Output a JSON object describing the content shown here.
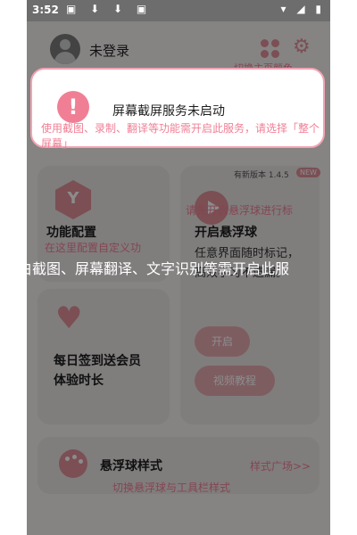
{
  "status_bar": {
    "time": "3:52",
    "notif_icons": "▣ ⬇ ⬇ ▣",
    "sys_icons": "▾ ◢ ▮"
  },
  "header": {
    "user": "未登录",
    "theme_label": "切换主页颜色"
  },
  "cards": {
    "function": {
      "title": "功能配置",
      "subtitle": "在这里配置自定义功",
      "icon_letter": "Y"
    },
    "floating": {
      "version": "有新版本 1.4.5",
      "badge": "NEW",
      "hint": "请先开启悬浮球进行标",
      "title": "开启悬浮球",
      "desc": "任意界面随时标记，高效学习不遗漏。",
      "start_btn": "开启",
      "video_btn": "视频教程"
    },
    "sign": {
      "title": "每日签到送会员体验时长"
    },
    "style": {
      "title": "悬浮球样式",
      "link": "样式广场>>",
      "subtitle": "切换悬浮球与工具栏样式"
    }
  },
  "dialog": {
    "title": "屏幕截屏服务未启动",
    "message": "使用截图、录制、翻译等功能需开启此服务，请选择「整个屏幕」"
  },
  "toast": "白截图、屏幕翻译、文字识别等需开启此服",
  "colors": {
    "accent": "#e0919a",
    "accent_text": "#f07f95",
    "dialog_border": "#f2a3b3"
  }
}
